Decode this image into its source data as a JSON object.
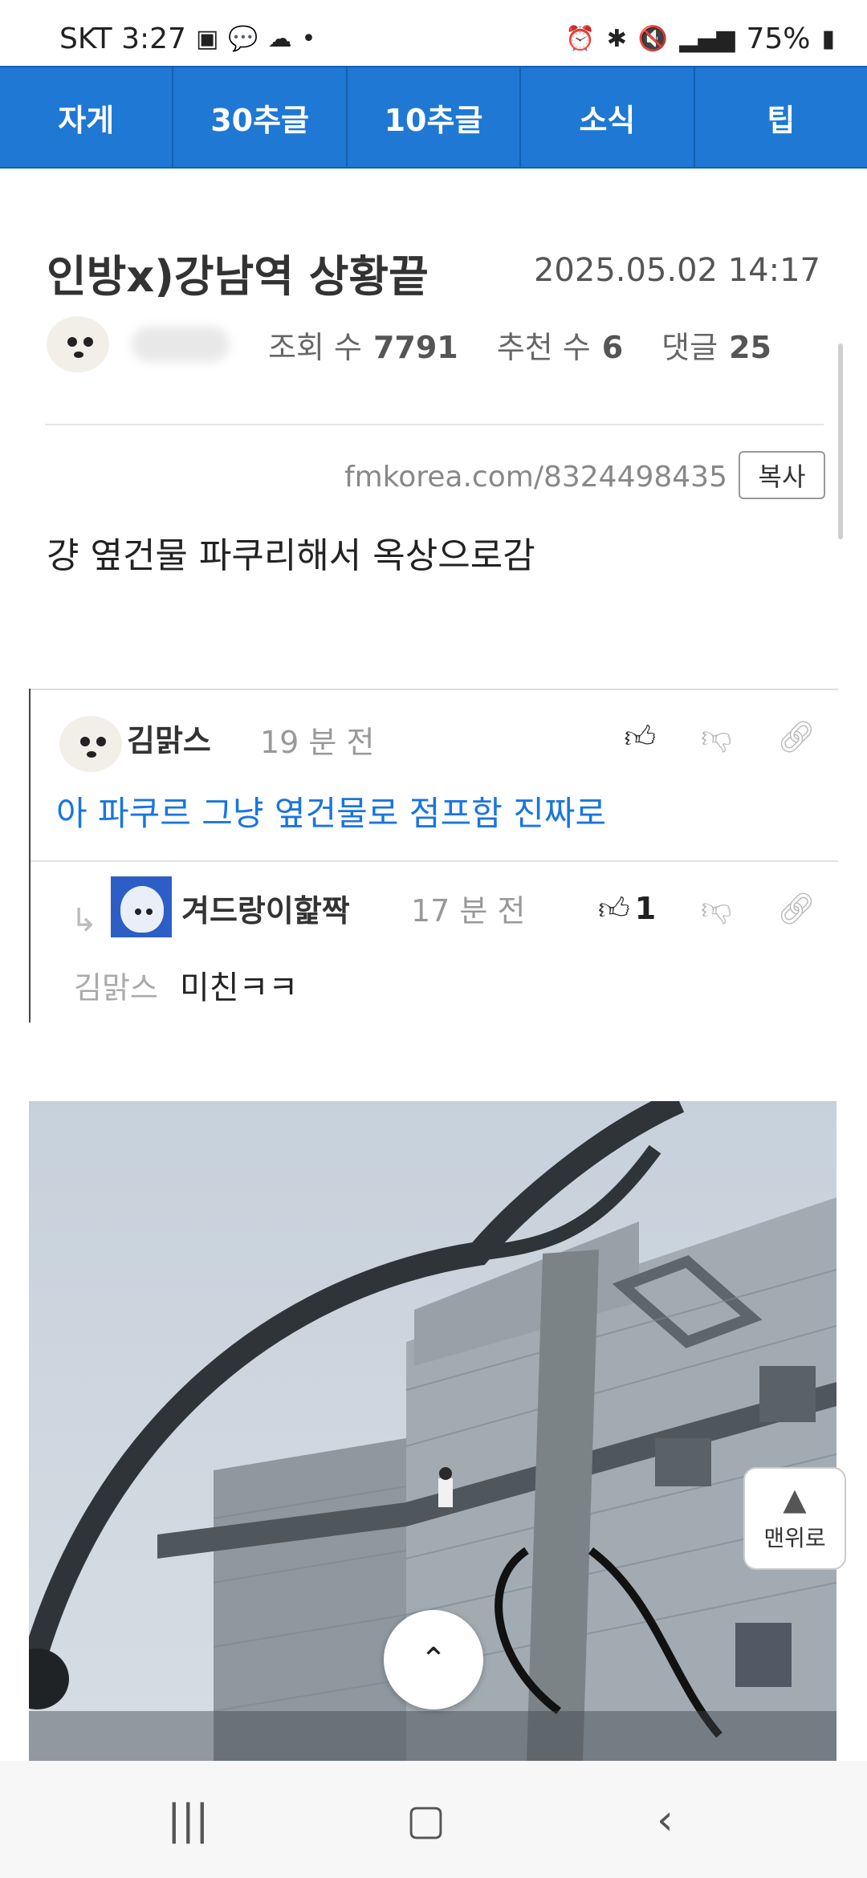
{
  "status_bar": {
    "carrier_time": "SKT 3:27",
    "left_icons": [
      "image-icon",
      "talk-icon",
      "chat-bubble-icon"
    ],
    "battery": "75%"
  },
  "nav": {
    "items": [
      "자게",
      "30추글",
      "10추글",
      "소식",
      "팁"
    ]
  },
  "post": {
    "title": "인방x)강남역 상황끝",
    "date": "2025.05.02 14:17",
    "views_label": "조회 수",
    "views": "7791",
    "recommend_label": "추천 수",
    "recommend": "6",
    "comments_label": "댓글",
    "comments": "25",
    "url": "fmkorea.com/8324498435",
    "copy_label": "복사",
    "body": "걍 옆건물 파쿠리해서 옥상으로감"
  },
  "comments": [
    {
      "nick": "김맑스",
      "time": "19 분 전",
      "text": "아 파쿠르 그냥 옆건물로 점프함 진짜로"
    },
    {
      "nick": "겨드랑이핥짝",
      "time": "17 분 전",
      "likes": "1",
      "mention": "김맑스",
      "text": "미친ㅋㅋ"
    }
  ],
  "floating": {
    "to_top_label": "맨위로"
  },
  "colors": {
    "nav_bg": "#1e78d4",
    "comment_text": "#1a75e0"
  }
}
